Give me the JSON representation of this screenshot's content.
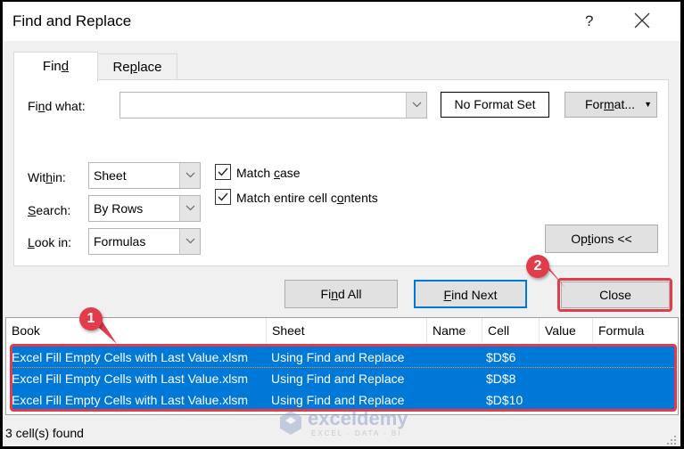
{
  "dialog": {
    "title": "Find and Replace",
    "help_label": "?",
    "tabs": [
      {
        "label": "Find",
        "underline": "d",
        "active": true
      },
      {
        "label": "Replace",
        "underline": "p",
        "active": false
      }
    ],
    "find_what": {
      "label": "Find what:",
      "value": "",
      "format_status": "No Format Set",
      "format_button": "Format..."
    },
    "within": {
      "label": "Within:",
      "value": "Sheet"
    },
    "search": {
      "label": "Search:",
      "value": "By Rows"
    },
    "look_in": {
      "label": "Look in:",
      "value": "Formulas"
    },
    "match_case": {
      "label": "Match case",
      "checked": true
    },
    "match_entire": {
      "label": "Match entire cell contents",
      "checked": true
    },
    "options_button": "Options <<",
    "find_all_button": "Find All",
    "find_next_button": "Find Next",
    "close_button": "Close"
  },
  "results": {
    "columns": [
      "Book",
      "Sheet",
      "Name",
      "Cell",
      "Value",
      "Formula"
    ],
    "rows": [
      {
        "book": "Excel Fill Empty Cells with Last Value.xlsm",
        "sheet": "Using Find and Replace",
        "name": "",
        "cell": "$D$6",
        "value": "",
        "formula": ""
      },
      {
        "book": "Excel Fill Empty Cells with Last Value.xlsm",
        "sheet": "Using Find and Replace",
        "name": "",
        "cell": "$D$8",
        "value": "",
        "formula": ""
      },
      {
        "book": "Excel Fill Empty Cells with Last Value.xlsm",
        "sheet": "Using Find and Replace",
        "name": "",
        "cell": "$D$10",
        "value": "",
        "formula": ""
      }
    ],
    "status": "3 cell(s) found"
  },
  "annotations": [
    {
      "number": "1",
      "target": "results rows"
    },
    {
      "number": "2",
      "target": "Close button"
    }
  ],
  "watermark": {
    "brand": "exceldemy",
    "tagline": "EXCEL - DATA - BI"
  },
  "colors": {
    "selection": "#0078d7",
    "annotation": "#e23b4a",
    "focus_border": "#0078d7"
  }
}
